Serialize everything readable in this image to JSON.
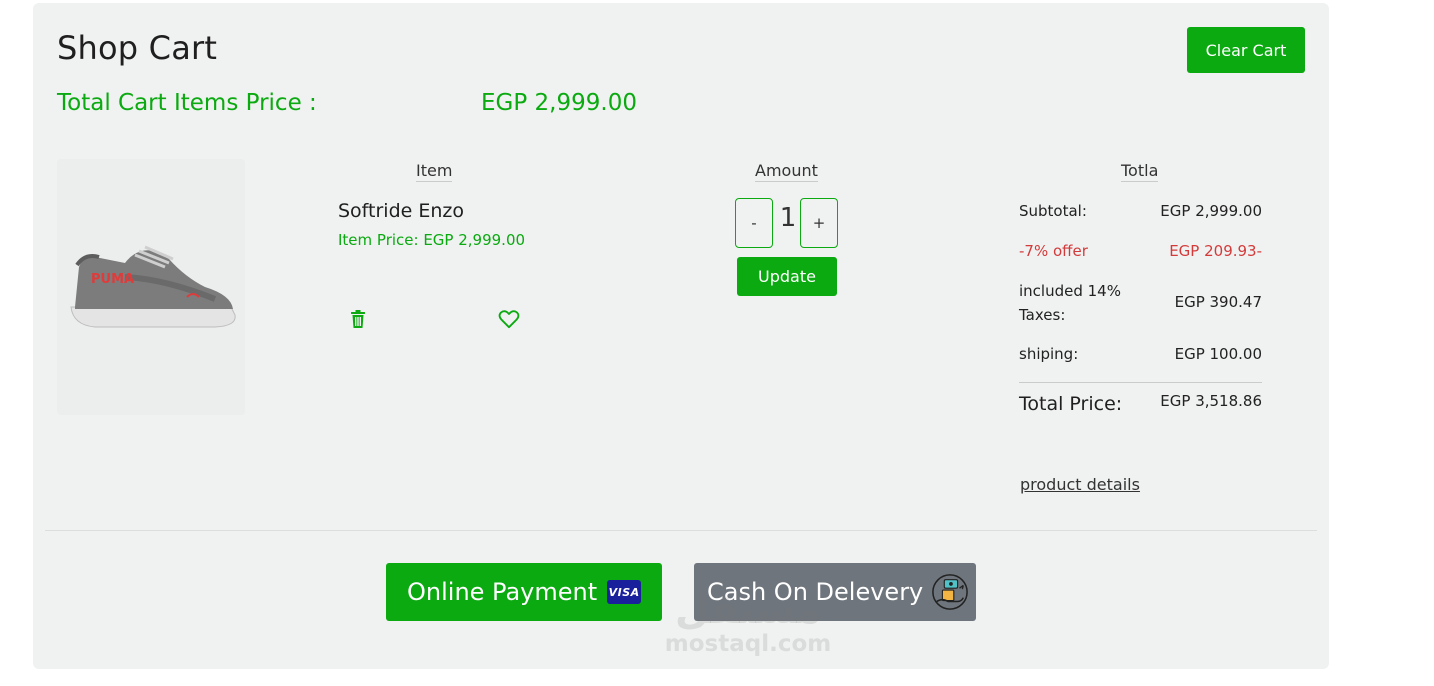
{
  "header": {
    "title": "Shop Cart",
    "clear_cart_label": "Clear Cart",
    "total_items_label": "Total Cart Items Price :",
    "total_items_value": "EGP 2,999.00"
  },
  "columns": {
    "item": "Item",
    "amount": "Amount",
    "total": "Totla"
  },
  "product": {
    "name": "Softride Enzo",
    "item_price": "Item Price: EGP 2,999.00",
    "image_icon": "sneaker-image",
    "quantity": "1",
    "decrement_label": "-",
    "increment_label": "+",
    "update_label": "Update",
    "delete_icon": "trash-icon",
    "wishlist_icon": "heart-icon"
  },
  "summary": {
    "subtotal_label": "Subtotal:",
    "subtotal_value": "EGP 2,999.00",
    "offer_label": "-7% offer",
    "offer_value": "EGP 209.93-",
    "taxes_label": "included 14% Taxes:",
    "taxes_value": "EGP 390.47",
    "shipping_label": "shiping:",
    "shipping_value": "EGP 100.00",
    "total_label": "Total Price:",
    "total_value": "EGP 3,518.86",
    "details_link": "product details"
  },
  "payment": {
    "online_label": "Online Payment",
    "visa_text": "VISA",
    "cod_label": "Cash On Delevery",
    "cod_icon": "cash-delivery-icon"
  },
  "watermark": {
    "arabic": "مستقل",
    "latin": "mostaql.com"
  },
  "colors": {
    "accent_green": "#0aaa10",
    "offer_red": "#d33b3b",
    "cod_gray": "#6e757c",
    "panel_bg": "#f0f1f1"
  }
}
